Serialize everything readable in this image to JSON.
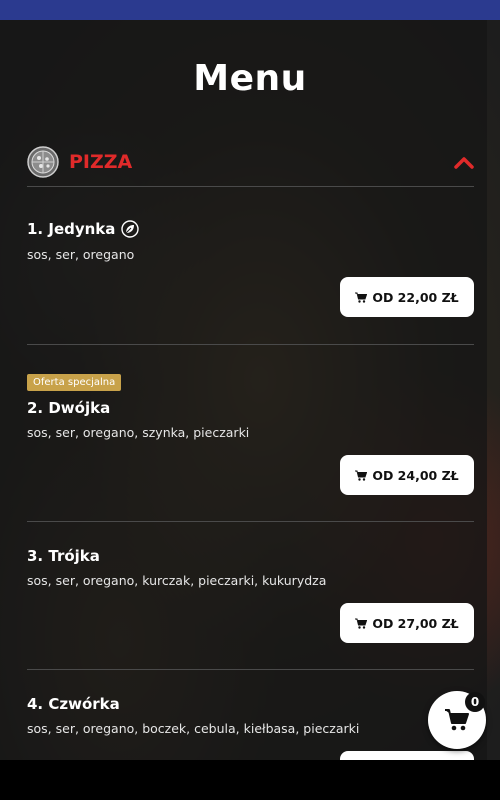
{
  "header": {
    "title": "Menu"
  },
  "section": {
    "title": "PIZZA",
    "icon": "pizza-icon",
    "collapse_icon": "chevron-up-icon"
  },
  "items": [
    {
      "name": "1. Jedynka",
      "description": "sos, ser, oregano",
      "price": "OD 22,00 ZŁ",
      "vegetarian": true
    },
    {
      "name": "2. Dwójka",
      "description": "sos, ser, oregano, szynka, pieczarki",
      "price": "OD 24,00 ZŁ",
      "badge": "Oferta specjalna"
    },
    {
      "name": "3. Trójka",
      "description": "sos, ser, oregano, kurczak, pieczarki, kukurydza",
      "price": "OD 27,00 ZŁ"
    },
    {
      "name": "4. Czwórka",
      "description": "sos, ser, oregano, boczek, cebula, kiełbasa, pieczarki"
    }
  ],
  "cart": {
    "count": "0",
    "icon": "cart-icon"
  },
  "colors": {
    "accent": "#e02a2a",
    "badge": "#c8a24a",
    "topbar": "#2b3a8f"
  }
}
